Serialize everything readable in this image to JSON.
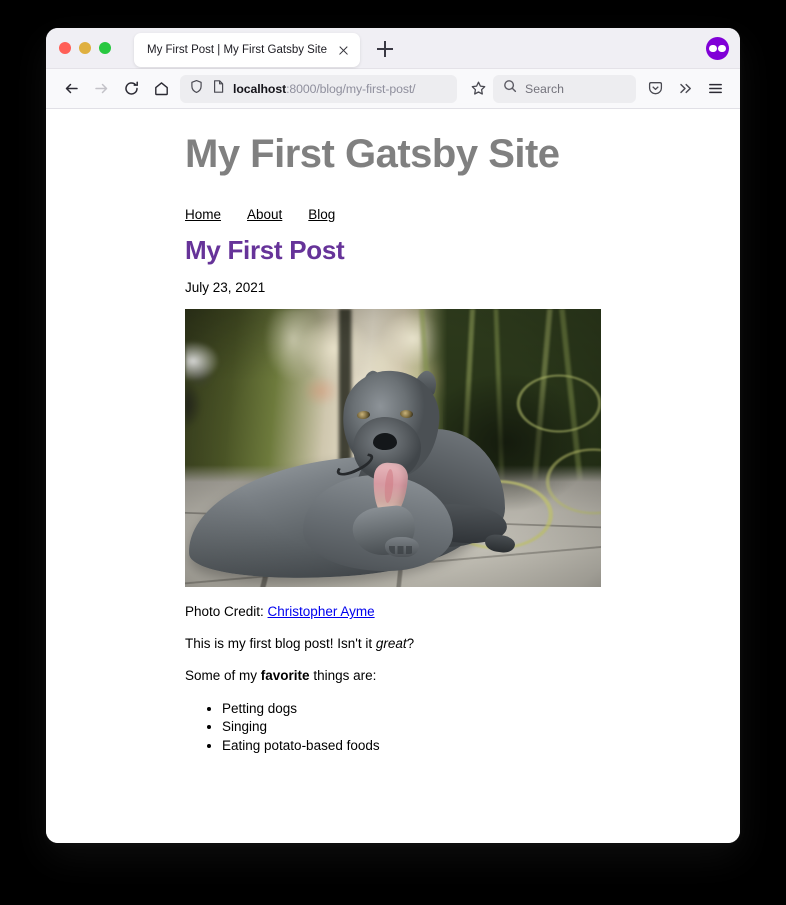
{
  "browser": {
    "window_controls": [
      "close",
      "minimize",
      "maximize"
    ],
    "tab": {
      "title": "My First Post | My First Gatsby Site",
      "close_icon": "close-icon"
    },
    "new_tab_label": "+",
    "extension_badge": "firefox-relay-icon",
    "toolbar": {
      "back_icon": "back-arrow-icon",
      "forward_icon": "forward-arrow-icon",
      "reload_icon": "reload-icon",
      "home_icon": "home-icon",
      "shield_icon": "shield-icon",
      "page_icon": "page-info-icon",
      "bookmark_icon": "star-icon",
      "pocket_icon": "pocket-icon",
      "overflow_icon": "double-chevron-icon",
      "menu_icon": "hamburger-menu-icon"
    },
    "url": {
      "host": "localhost",
      "rest": ":8000/blog/my-first-post/"
    },
    "search": {
      "placeholder": "Search",
      "icon": "search-icon"
    }
  },
  "page": {
    "site_title": "My First Gatsby Site",
    "nav": [
      {
        "label": "Home"
      },
      {
        "label": "About"
      },
      {
        "label": "Blog"
      }
    ],
    "post_title": "My First Post",
    "post_date": "July 23, 2021",
    "photo": {
      "alt": "Gray pit bull dog lying on a paved sidewalk with green foliage",
      "credit_prefix": "Photo Credit: ",
      "credit_link": "Christopher Ayme"
    },
    "paragraph_1": {
      "before": "This is my first blog post! Isn't it ",
      "emphasis": "great",
      "after": "?"
    },
    "paragraph_2": {
      "before": "Some of my ",
      "strong": "favorite",
      "after": " things are:"
    },
    "favorites": [
      "Petting dogs",
      "Singing",
      "Eating potato-based foods"
    ]
  },
  "colors": {
    "brand_purple": "#663399",
    "site_title_gray": "#808080",
    "link_blue": "#0000ee",
    "relay_purple": "#8000d7"
  }
}
